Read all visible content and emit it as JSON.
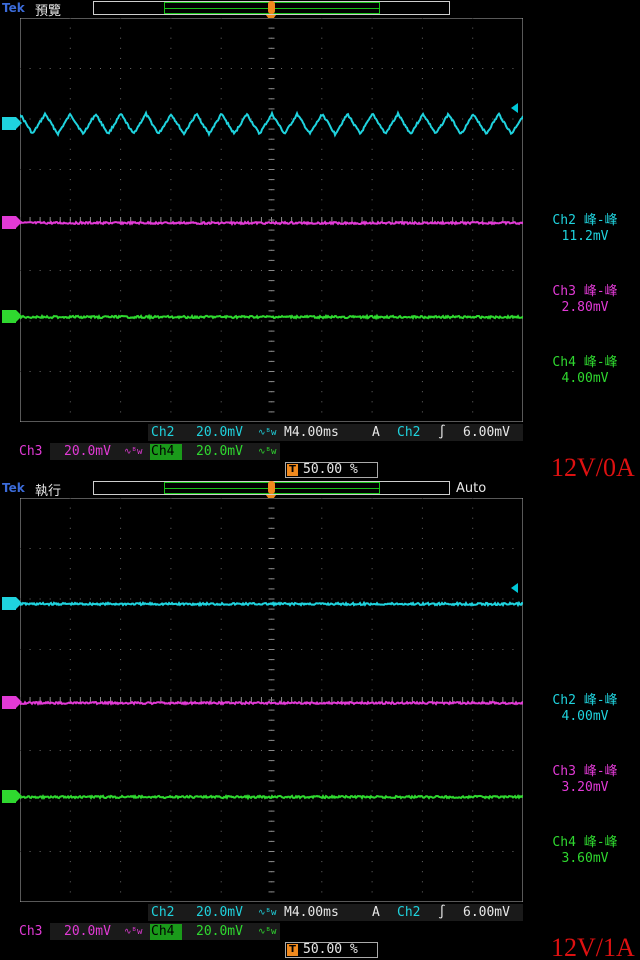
{
  "brand": "Tek",
  "colors": {
    "ch2": "#1fd3de",
    "ch3": "#e23ad6",
    "ch4": "#2fd82f",
    "trigger": "#f08a1e",
    "load_label": "#dd1111"
  },
  "panels": [
    {
      "mode": "預覽",
      "auto": "",
      "channel_markers": [
        "2",
        "3",
        "4"
      ],
      "trigger_marker": "T",
      "ch2_waveform": "triangle",
      "measurements": [
        {
          "label": "Ch2 峰-峰",
          "value": "11.2mV"
        },
        {
          "label": "Ch3 峰-峰",
          "value": "2.80mV"
        },
        {
          "label": "Ch4 峰-峰",
          "value": "4.00mV"
        }
      ],
      "settings": {
        "ch2": "Ch2",
        "ch2_scale": "20.0mV",
        "ch3": "Ch3",
        "ch3_scale": "20.0mV",
        "ch4": "Ch4",
        "ch4_scale": "20.0mV",
        "timebase": "M4.00ms",
        "trigger_mode": "A",
        "trigger_source": "Ch2",
        "trigger_slope": "∫",
        "trigger_level": "6.00mV",
        "trigger_position": "50.00 %",
        "trigger_badge": "T"
      },
      "load": "12V/0A"
    },
    {
      "mode": "執行",
      "auto": "Auto",
      "channel_markers": [
        "2",
        "3",
        "4"
      ],
      "trigger_marker": "T",
      "ch2_waveform": "flat",
      "measurements": [
        {
          "label": "Ch2 峰-峰",
          "value": "4.00mV"
        },
        {
          "label": "Ch3 峰-峰",
          "value": "3.20mV"
        },
        {
          "label": "Ch4 峰-峰",
          "value": "3.60mV"
        }
      ],
      "settings": {
        "ch2": "Ch2",
        "ch2_scale": "20.0mV",
        "ch3": "Ch3",
        "ch3_scale": "20.0mV",
        "ch4": "Ch4",
        "ch4_scale": "20.0mV",
        "timebase": "M4.00ms",
        "trigger_mode": "A",
        "trigger_source": "Ch2",
        "trigger_slope": "∫",
        "trigger_level": "6.00mV",
        "trigger_position": "50.00 %",
        "trigger_badge": "T"
      },
      "load": "12V/1A"
    }
  ]
}
